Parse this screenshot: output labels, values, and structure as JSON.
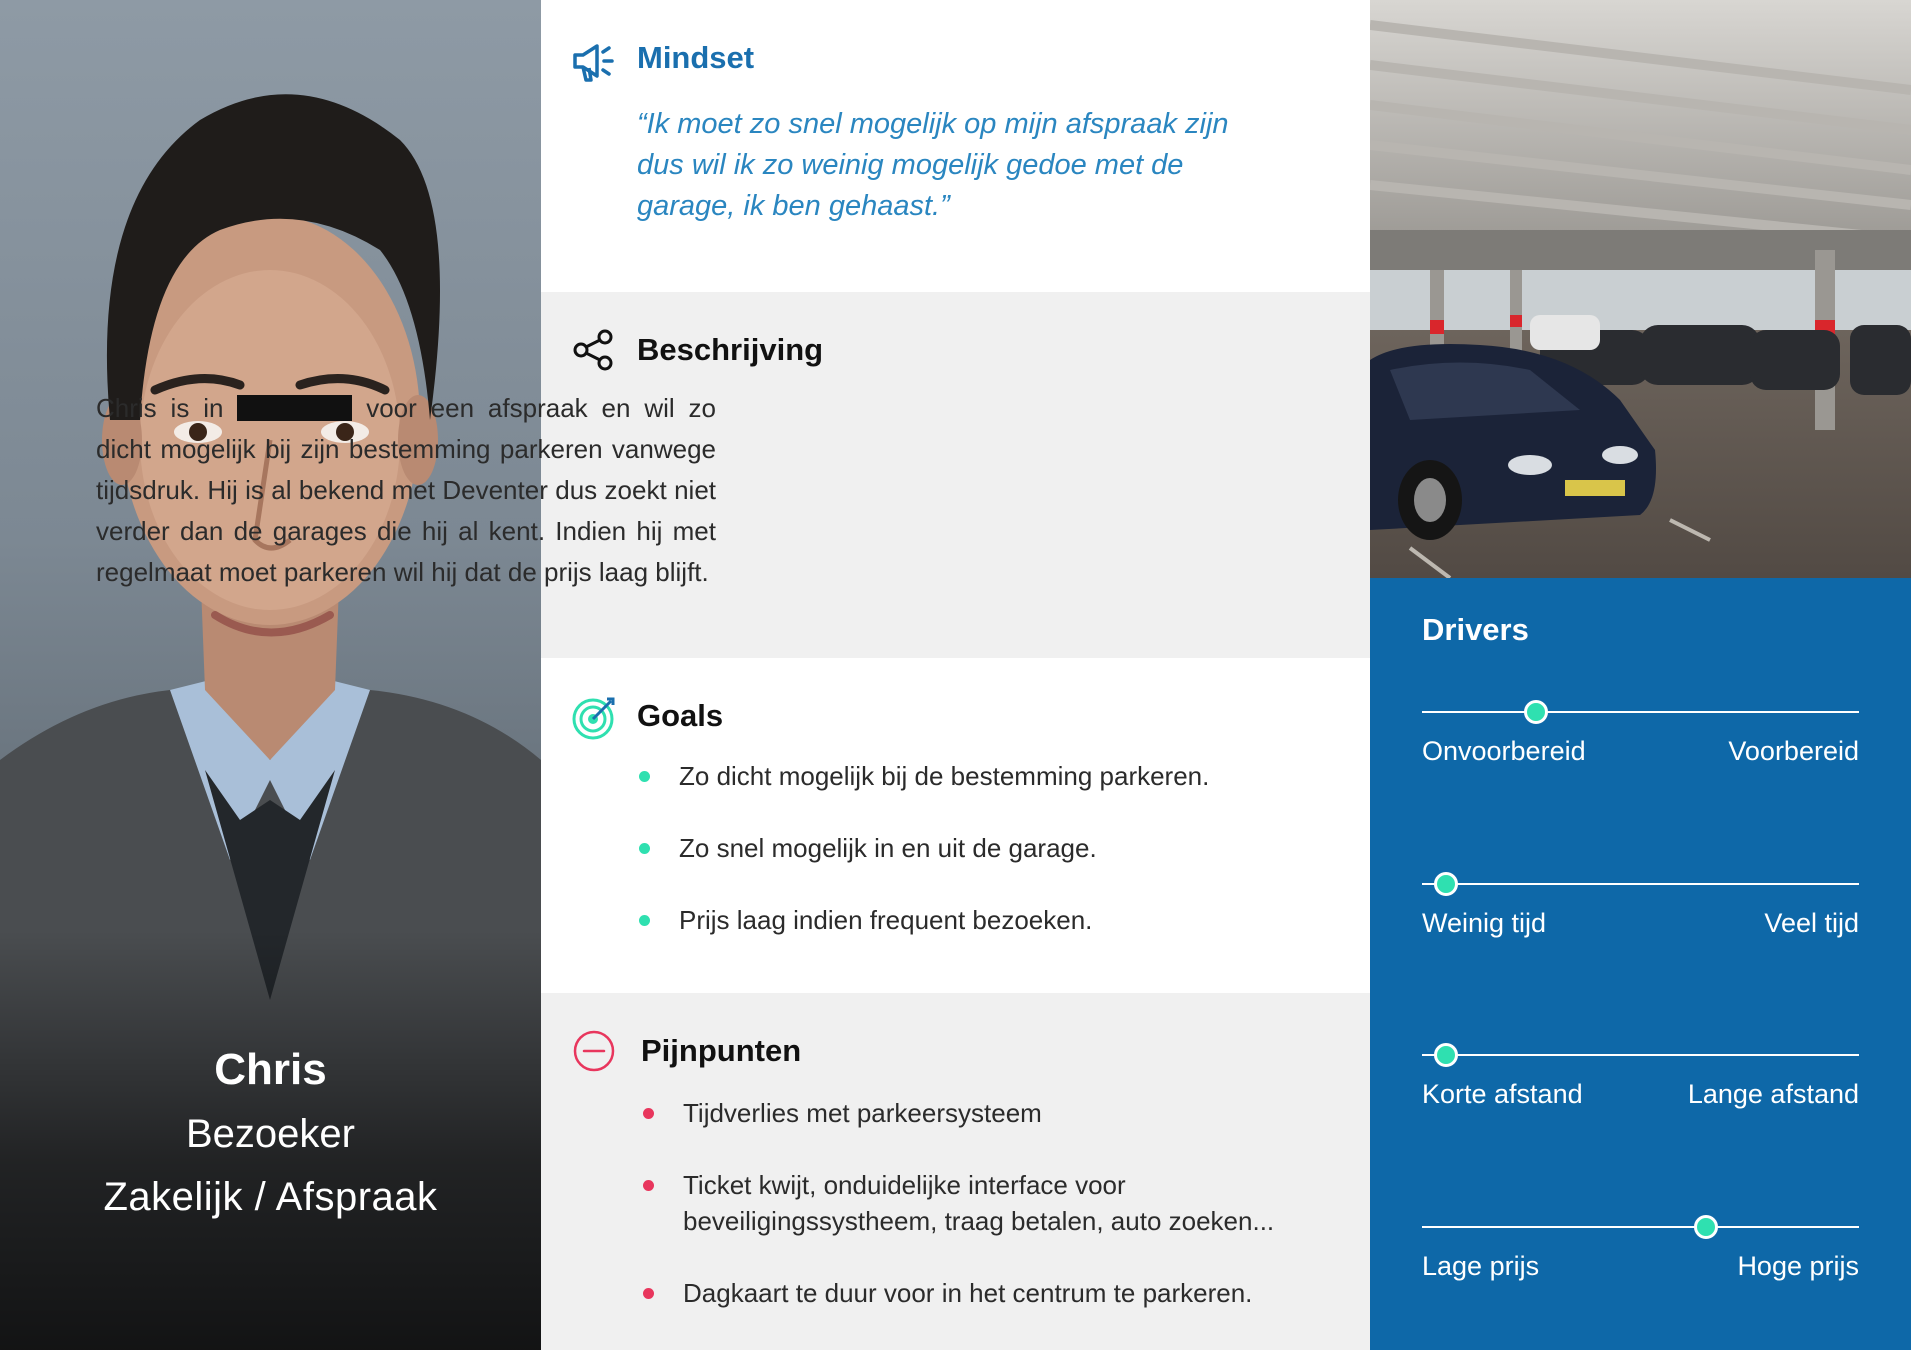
{
  "persona": {
    "name": "Chris",
    "role": "Bezoeker",
    "context": "Zakelijk / Afspraak"
  },
  "mindset": {
    "title": "Mindset",
    "icon": "megaphone-icon",
    "quote": "“Ik moet zo snel mogelijk op mijn afspraak zijn dus wil ik zo weinig mogelijk gedoe met de garage, ik ben gehaast.”"
  },
  "beschrijving": {
    "title": "Beschrijving",
    "icon": "share-icon",
    "text_before": "Chris is in",
    "text_after": "voor een afspraak en wil zo dicht mogelijk bij zijn bestemming parkeren vanwege tijdsdruk. Hij is al bekend met Deventer dus zoekt niet verder dan de garages die hij al kent. Indien hij met regelmaat moet parkeren wil hij dat de prijs laag blijft."
  },
  "goals": {
    "title": "Goals",
    "icon": "target-icon",
    "items": [
      "Zo dicht mogelijk bij de bestemming parkeren.",
      "Zo snel mogelijk in en uit de garage.",
      "Prijs laag indien frequent bezoeken."
    ]
  },
  "pijnpunten": {
    "title": "Pijnpunten",
    "icon": "minus-circle-icon",
    "items": [
      "Tijdverlies met parkeersysteem",
      "Ticket kwijt, onduidelijke interface voor beveiligingssystheem, traag betalen, auto zoeken...",
      "Dagkaart te duur voor in het centrum te parkeren."
    ]
  },
  "drivers": {
    "title": "Drivers",
    "items": [
      {
        "left": "Onvoorbereid",
        "right": "Voorbereid",
        "value": 0.26
      },
      {
        "left": "Weinig tijd",
        "right": "Veel tijd",
        "value": 0.055
      },
      {
        "left": "Korte afstand",
        "right": "Lange afstand",
        "value": 0.055
      },
      {
        "left": "Lage prijs",
        "right": "Hoge prijs",
        "value": 0.65
      }
    ]
  },
  "colors": {
    "accent_blue": "#0e68a8",
    "quote_blue": "#2a86c0",
    "goal_green": "#2fe0b0",
    "pain_red": "#e8365d",
    "panel_grey": "#f0f0f0"
  }
}
